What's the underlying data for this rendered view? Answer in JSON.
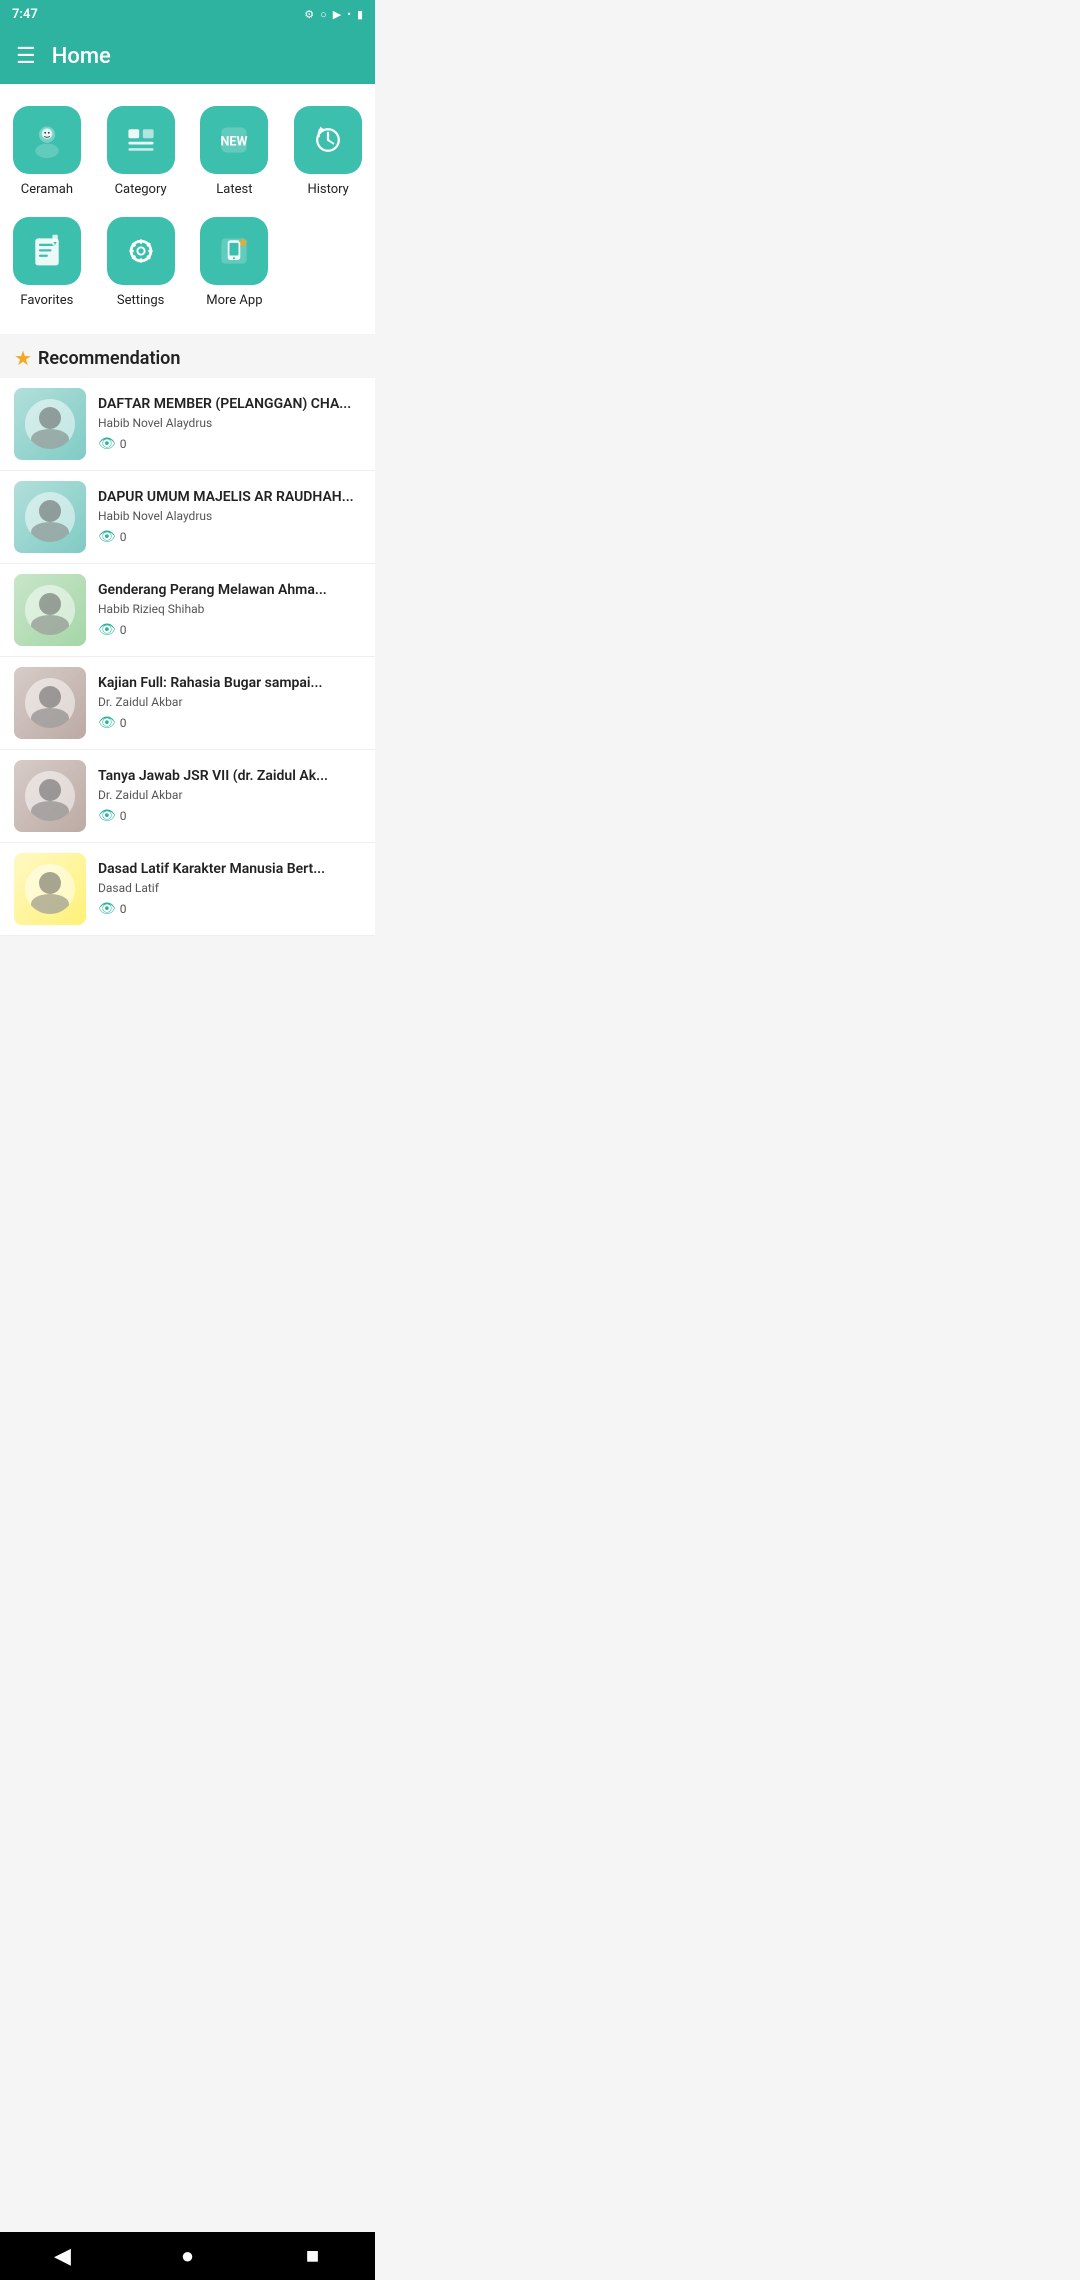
{
  "status": {
    "time": "7:47",
    "battery": "battery-icon"
  },
  "appBar": {
    "title": "Home",
    "menuIcon": "☰"
  },
  "gridMenu": [
    {
      "id": "ceramah",
      "label": "Ceramah",
      "icon": "ceramah"
    },
    {
      "id": "category",
      "label": "Category",
      "icon": "category"
    },
    {
      "id": "latest",
      "label": "Latest",
      "icon": "latest"
    },
    {
      "id": "history",
      "label": "History",
      "icon": "history"
    },
    {
      "id": "favorites",
      "label": "Favorites",
      "icon": "favorites"
    },
    {
      "id": "settings",
      "label": "Settings",
      "icon": "settings"
    },
    {
      "id": "moreapp",
      "label": "More App",
      "icon": "moreapp"
    }
  ],
  "recommendation": {
    "sectionTitle": "Recommendation",
    "starIcon": "★",
    "items": [
      {
        "id": 1,
        "title": "DAFTAR MEMBER (PELANGGAN) CHA...",
        "author": "Habib Novel Alaydrus",
        "views": "0",
        "avatarClass": "avatar-habib1"
      },
      {
        "id": 2,
        "title": "DAPUR UMUM MAJELIS AR RAUDHAH...",
        "author": "Habib Novel Alaydrus",
        "views": "0",
        "avatarClass": "avatar-habib2"
      },
      {
        "id": 3,
        "title": "Genderang Perang Melawan Ahma...",
        "author": "Habib Rizieq Shihab",
        "views": "0",
        "avatarClass": "avatar-rizieq"
      },
      {
        "id": 4,
        "title": "Kajian Full: Rahasia Bugar sampai...",
        "author": "Dr. Zaidul Akbar",
        "views": "0",
        "avatarClass": "avatar-zaidul1"
      },
      {
        "id": 5,
        "title": "Tanya Jawab JSR VII (dr. Zaidul Ak...",
        "author": "Dr. Zaidul Akbar",
        "views": "0",
        "avatarClass": "avatar-zaidul2"
      },
      {
        "id": 6,
        "title": "Dasad Latif   Karakter Manusia Bert...",
        "author": "Dasad Latif",
        "views": "0",
        "avatarClass": "avatar-dasad"
      }
    ]
  },
  "bottomNav": {
    "backIcon": "◀",
    "homeIcon": "●",
    "recentIcon": "■"
  }
}
